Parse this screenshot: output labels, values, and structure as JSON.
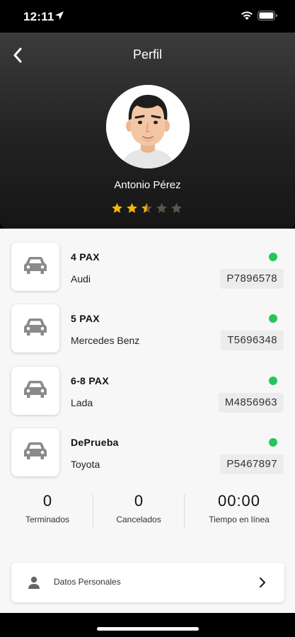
{
  "status_bar": {
    "time": "12:11"
  },
  "header": {
    "title": "Perfil"
  },
  "profile": {
    "name": "Antonio Pérez",
    "rating": 2.5,
    "rating_max": 5
  },
  "vehicles": [
    {
      "pax": "4 PAX",
      "brand": "Audi",
      "plate": "P7896578",
      "active": true
    },
    {
      "pax": "5 PAX",
      "brand": "Mercedes Benz",
      "plate": "T5696348",
      "active": true
    },
    {
      "pax": "6-8 PAX",
      "brand": "Lada",
      "plate": "M4856963",
      "active": true
    },
    {
      "pax": "DePrueba",
      "brand": "Toyota",
      "plate": "P5467897",
      "active": true
    }
  ],
  "stats": {
    "finished": {
      "value": "0",
      "label": "Terminados"
    },
    "cancelled": {
      "value": "0",
      "label": "Cancelados"
    },
    "online_time": {
      "value": "00:00",
      "label": "Tiempo en línea"
    }
  },
  "personal_data": {
    "label": "Datos Personales"
  },
  "colors": {
    "star": "#f2b705",
    "star_empty": "#5c5647",
    "active_dot": "#25c45c"
  }
}
